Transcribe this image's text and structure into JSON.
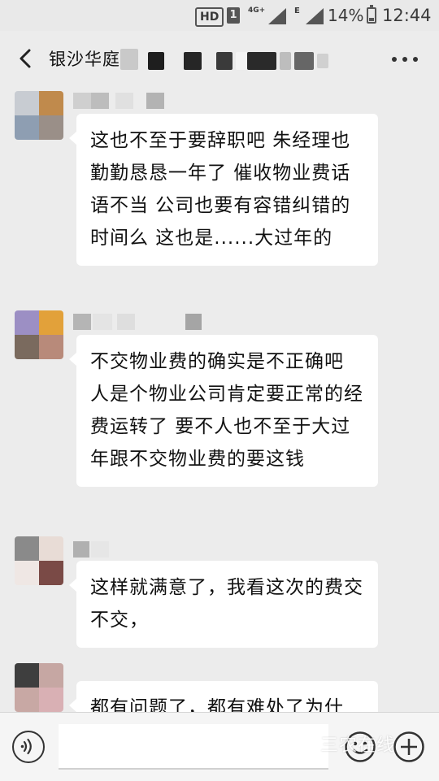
{
  "status_bar": {
    "hd": "HD",
    "sim": "1",
    "network": "4G+",
    "network2": "E",
    "battery": "14%",
    "time": "12:44"
  },
  "header": {
    "title": "银沙华庭",
    "back_icon": "chevron-left-icon",
    "more_icon": "more-dots-icon"
  },
  "messages": [
    {
      "text": "这也不至于要辞职吧 朱经理也勤勤恳恳一年了 催收物业费话语不当 公司也要有容错纠错的时间么 这也是......大过年的"
    },
    {
      "text": "不交物业费的确实是不正确吧 人是个物业公司肯定要正常的经费运转了 要不人也不至于大过年跟不交物业费的要这钱"
    },
    {
      "text": "这样就满意了，我看这次的费交不交，"
    },
    {
      "text": "都有问题了，都有难处了为什"
    }
  ],
  "input_bar": {
    "voice_icon": "voice-icon",
    "input_value": "",
    "emoji_icon": "emoji-icon",
    "add_icon": "plus-icon"
  },
  "watermark": {
    "text": "三农在线"
  },
  "colors": {
    "background": "#ececec",
    "bubble": "#ffffff",
    "text": "#111111"
  }
}
